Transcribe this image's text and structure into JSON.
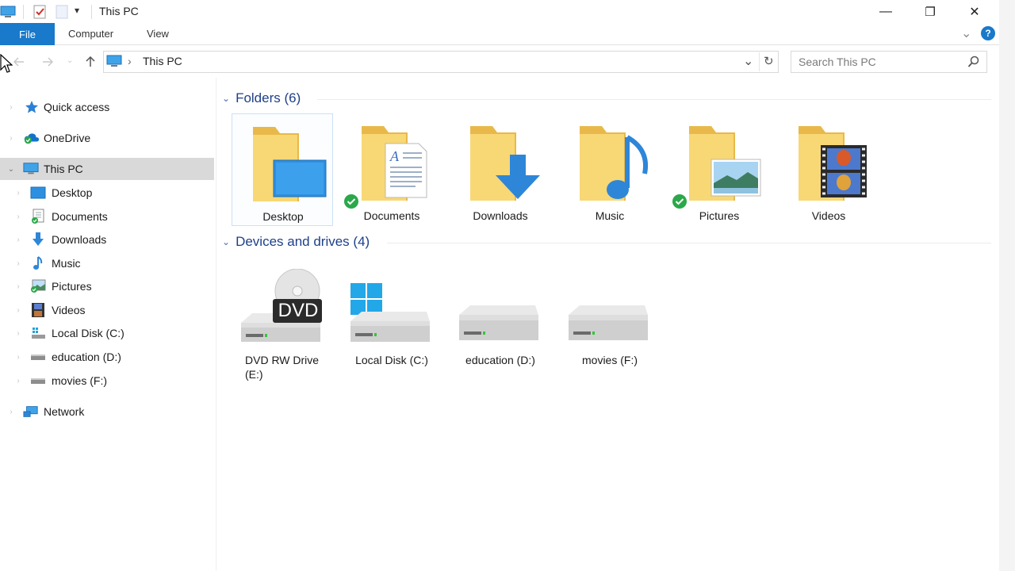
{
  "window": {
    "title": "This PC",
    "quick_access_dropdown": "▾",
    "minimize": "—",
    "restore": "❐",
    "close": "✕"
  },
  "ribbon": {
    "tabs": [
      "File",
      "Computer",
      "View"
    ],
    "expand_glyph": "⌄",
    "help_glyph": "?"
  },
  "address": {
    "path_label": "This PC",
    "separator": "›",
    "dropdown_glyph": "⌄",
    "refresh_glyph": "↻"
  },
  "search": {
    "placeholder": "Search This PC"
  },
  "nav": {
    "items": [
      {
        "label": "Quick access",
        "icon": "star-icon"
      },
      {
        "label": "OneDrive",
        "icon": "cloud-icon"
      },
      {
        "label": "This PC",
        "icon": "monitor-icon"
      },
      {
        "label": "Desktop",
        "icon": "desktop-icon"
      },
      {
        "label": "Documents",
        "icon": "documents-icon"
      },
      {
        "label": "Downloads",
        "icon": "download-arrow-icon"
      },
      {
        "label": "Music",
        "icon": "music-note-icon"
      },
      {
        "label": "Pictures",
        "icon": "pictures-icon"
      },
      {
        "label": "Videos",
        "icon": "film-icon"
      },
      {
        "label": "Local Disk (C:)",
        "icon": "drive-icon"
      },
      {
        "label": "education (D:)",
        "icon": "drive-icon"
      },
      {
        "label": "movies (F:)",
        "icon": "drive-icon"
      },
      {
        "label": "Network",
        "icon": "network-icon"
      }
    ]
  },
  "groups": {
    "folders_header": "Folders (6)",
    "devices_header": "Devices and drives (4)"
  },
  "folders": [
    {
      "label": "Desktop",
      "icon": "desktop-folder-icon",
      "synced": false
    },
    {
      "label": "Documents",
      "icon": "documents-folder-icon",
      "synced": true
    },
    {
      "label": "Downloads",
      "icon": "downloads-folder-icon",
      "synced": false
    },
    {
      "label": "Music",
      "icon": "music-folder-icon",
      "synced": false
    },
    {
      "label": "Pictures",
      "icon": "pictures-folder-icon",
      "synced": true
    },
    {
      "label": "Videos",
      "icon": "videos-folder-icon",
      "synced": false
    }
  ],
  "drives": [
    {
      "label_line1": "DVD RW Drive",
      "label_line2": "(E:)",
      "icon": "dvd-drive-icon",
      "badge": "DVD"
    },
    {
      "label_line1": "Local Disk (C:)",
      "label_line2": "",
      "icon": "windows-drive-icon",
      "badge": ""
    },
    {
      "label_line1": "education (D:)",
      "label_line2": "",
      "icon": "drive-icon",
      "badge": ""
    },
    {
      "label_line1": "movies (F:)",
      "label_line2": "",
      "icon": "drive-icon",
      "badge": ""
    }
  ],
  "colors": {
    "accent": "#1979ca",
    "folder": "#f8d775",
    "folder_dark": "#e8b94a",
    "group_header": "#1e3f8a",
    "sync_green": "#2aa84a"
  }
}
